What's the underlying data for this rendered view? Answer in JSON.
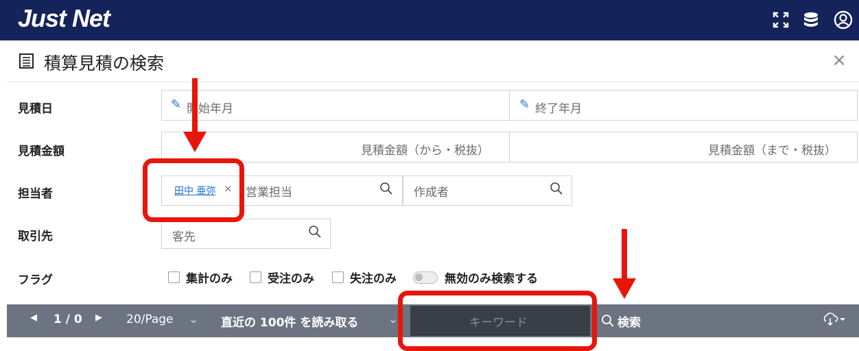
{
  "header": {
    "logo": "Just Net",
    "icons": [
      "fullscreen-icon",
      "database-icon",
      "user-icon"
    ]
  },
  "dialog": {
    "title": "積算見積の検索"
  },
  "form": {
    "date": {
      "label": "見積日",
      "start_placeholder": "開始年月",
      "end_placeholder": "終了年月"
    },
    "amount": {
      "label": "見積金額",
      "from_placeholder": "見積金額（から・税抜）",
      "to_placeholder": "見積金額（まで・税抜）"
    },
    "staff": {
      "label": "担当者",
      "tag": "田中 亜弥",
      "tag_remove": "×",
      "sales_placeholder": "営業担当",
      "creator_placeholder": "作成者"
    },
    "client": {
      "label": "取引先",
      "placeholder": "客先"
    },
    "flags": {
      "label": "フラグ",
      "options": [
        "集計のみ",
        "受注のみ",
        "失注のみ"
      ],
      "toggle_label": "無効のみ検索する"
    }
  },
  "toolbar": {
    "page_indicator": "1 / 0",
    "per_page": "20/Page",
    "recent_load": "直近の 100件 を読み取る",
    "keyword_placeholder": "キーワード",
    "search_label": "検索"
  },
  "colors": {
    "header_bg": "#14235a",
    "toolbar_bg": "#6b7480",
    "annotation": "#e8150b",
    "link": "#1a6fd6"
  }
}
